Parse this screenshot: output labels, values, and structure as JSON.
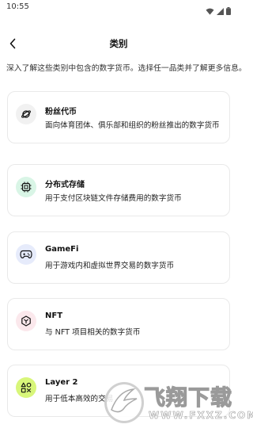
{
  "status_bar": {
    "time": "10:55",
    "icons": [
      "wifi-icon",
      "signal-icon",
      "battery-icon"
    ]
  },
  "header": {
    "back_icon": "chevron-left-icon",
    "title": "类别"
  },
  "intro": "深入了解这些类别中包含的数字货币。选择任一品类并了解更多信息。",
  "categories": [
    {
      "title": "粉丝代币",
      "description": "面向体育团体、俱乐部和组织的粉丝推出的数字货币",
      "icon": "planet-icon",
      "icon_bg": "#f1f1f1"
    },
    {
      "title": "分布式存储",
      "description": "用于支付区块链文件存储费用的数字货币",
      "icon": "chip-icon",
      "icon_bg": "#d9f5e6"
    },
    {
      "title": "GameFi",
      "description": "用于游戏内和虚拟世界交易的数字货币",
      "icon": "gamepad-icon",
      "icon_bg": "#e6ebfb"
    },
    {
      "title": "NFT",
      "description": "与 NFT 项目相关的数字货币",
      "icon": "nft-icon",
      "icon_bg": "#fbe8ec"
    },
    {
      "title": "Layer 2",
      "description": "用于低本高效的交易",
      "icon": "layers-icon",
      "icon_bg": "#d8f67a"
    }
  ],
  "watermark": {
    "text": "飞翔下载",
    "url": "WWW.FXXZ.COM"
  }
}
